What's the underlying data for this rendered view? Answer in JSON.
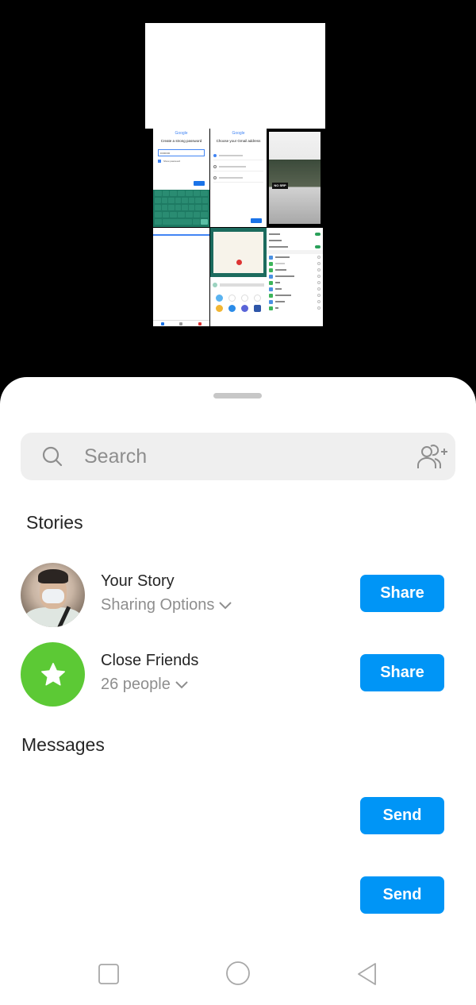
{
  "preview": {
    "thumbnails": [
      {
        "id": "google-password",
        "logo": "Google",
        "title": "Create a strong password",
        "field_value": "••••••••••",
        "checkbox_label": "Show password"
      },
      {
        "id": "google-gmail",
        "logo": "Google",
        "title": "Choose your Gmail address",
        "options": [
          "",
          "",
          ""
        ]
      },
      {
        "id": "photo",
        "sign_text": "NO SRP"
      },
      {
        "id": "blank-app"
      },
      {
        "id": "certificate-share"
      },
      {
        "id": "settings-list"
      }
    ]
  },
  "sheet": {
    "search": {
      "placeholder": "Search",
      "value": ""
    },
    "stories_title": "Stories",
    "stories": [
      {
        "title": "Your Story",
        "subtitle": "Sharing Options",
        "button": "Share",
        "avatar": "profile-photo"
      },
      {
        "title": "Close Friends",
        "subtitle": "26 people",
        "button": "Share",
        "avatar": "star-icon"
      }
    ],
    "messages_title": "Messages",
    "messages": [
      {
        "name": "",
        "button": "Send"
      },
      {
        "name": "",
        "button": "Send"
      }
    ]
  },
  "colors": {
    "accent_blue": "#0095f6",
    "close_friends_green": "#5cc935",
    "search_bg": "#efefef",
    "secondary_text": "#8e8e8e"
  },
  "navigation": {
    "buttons": [
      "recents",
      "home",
      "back"
    ]
  }
}
